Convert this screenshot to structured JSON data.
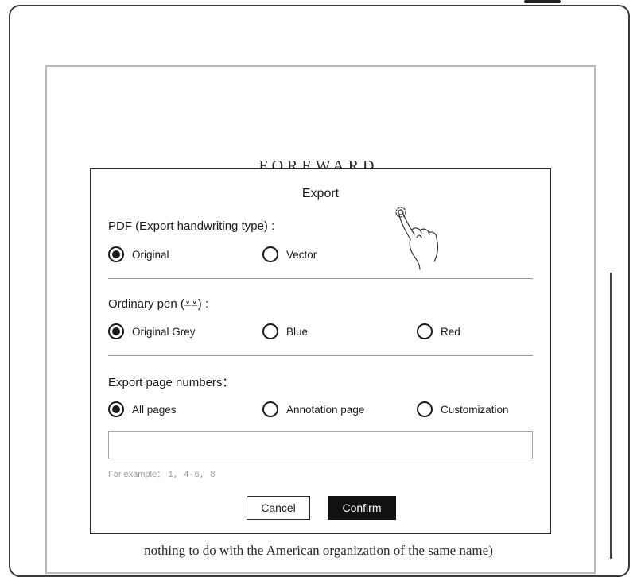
{
  "document": {
    "heading": "FOREWARD",
    "bottom_line": "nothing to do with the American organization of the same name)"
  },
  "dialog": {
    "title": "Export",
    "pdf_section": {
      "label": "PDF (Export handwriting type) :",
      "options": [
        {
          "label": "Original",
          "selected": true
        },
        {
          "label": "Vector",
          "selected": false
        }
      ]
    },
    "pen_section": {
      "label": "Ordinary pen (⩡⩡) :",
      "options": [
        {
          "label": "Original Grey",
          "selected": true
        },
        {
          "label": "Blue",
          "selected": false
        },
        {
          "label": "Red",
          "selected": false
        }
      ]
    },
    "pages_section": {
      "label": "Export page numbers：",
      "options": [
        {
          "label": "All pages",
          "selected": true
        },
        {
          "label": "Annotation page",
          "selected": false
        },
        {
          "label": "Customization",
          "selected": false
        }
      ],
      "input_value": "",
      "hint_prefix": "For example：",
      "hint_example": "1, 4-6, 8"
    },
    "buttons": {
      "cancel": "Cancel",
      "confirm": "Confirm"
    }
  },
  "icons": {
    "tap_gesture": "hand-tap-icon"
  }
}
